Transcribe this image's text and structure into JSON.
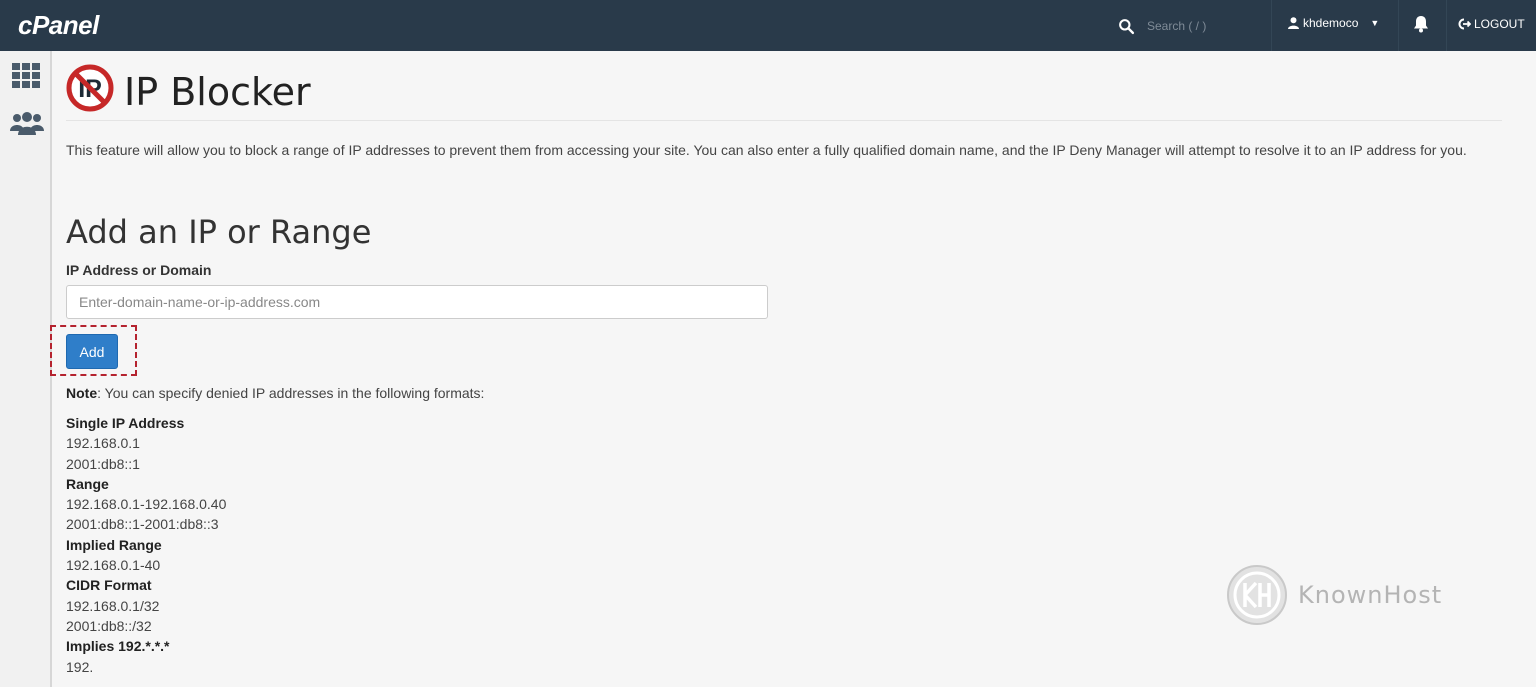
{
  "topbar": {
    "logo": "cPanel",
    "search_placeholder": "Search ( / )",
    "username": "khdemoco",
    "logout_label": "LOGOUT",
    "background": "#293a4a"
  },
  "sidebar": {
    "items": [
      {
        "icon": "grid-icon"
      },
      {
        "icon": "users-icon"
      }
    ]
  },
  "page": {
    "title": "IP Blocker",
    "icon": "ip-blocker-icon",
    "description": "This feature will allow you to block a range of IP addresses to prevent them from accessing your site. You can also enter a fully qualified domain name, and the IP Deny Manager will attempt to resolve it to an IP address for you."
  },
  "form": {
    "section_title": "Add an IP or Range",
    "field_label": "IP Address or Domain",
    "field_value": "",
    "field_placeholder": "Enter-domain-name-or-ip-address.com",
    "add_label": "Add",
    "accent": "#2f7ec9"
  },
  "note": {
    "bold": "Note",
    "text": ": You can specify denied IP addresses in the following formats:"
  },
  "formats": [
    {
      "heading": "Single IP Address",
      "lines": [
        "192.168.0.1",
        "2001:db8::1"
      ]
    },
    {
      "heading": "Range",
      "lines": [
        "192.168.0.1-192.168.0.40",
        "2001:db8::1-2001:db8::3"
      ]
    },
    {
      "heading": "Implied Range",
      "lines": [
        "192.168.0.1-40"
      ]
    },
    {
      "heading": "CIDR Format",
      "lines": [
        "192.168.0.1/32",
        "2001:db8::/32"
      ]
    },
    {
      "heading": "Implies 192.*.*.*",
      "lines": [
        "192."
      ]
    }
  ],
  "watermark": {
    "text": "KnownHost"
  }
}
